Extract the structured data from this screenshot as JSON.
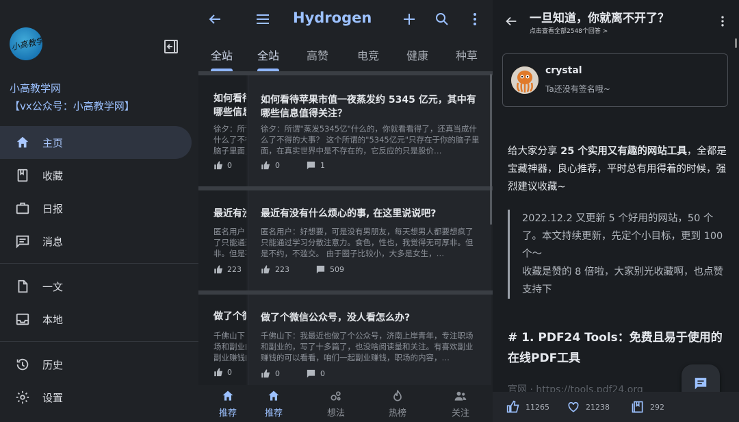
{
  "drawer": {
    "avatar_text": "小高教学网",
    "name": "小高教学网",
    "subtitle": "【vx公众号：小高教学网】",
    "items": [
      {
        "label": "主页",
        "icon": "home-icon"
      },
      {
        "label": "收藏",
        "icon": "bookmark-icon"
      },
      {
        "label": "日报",
        "icon": "briefcase-icon"
      },
      {
        "label": "消息",
        "icon": "message-icon"
      },
      {
        "label": "一文",
        "icon": "document-icon"
      },
      {
        "label": "本地",
        "icon": "inbox-icon"
      },
      {
        "label": "历史",
        "icon": "history-icon"
      },
      {
        "label": "设置",
        "icon": "gear-icon"
      }
    ]
  },
  "list": {
    "app_title": "Hydrogen",
    "ghost_tab": "全站",
    "tabs": [
      "全站",
      "高赞",
      "电竞",
      "健康",
      "种草"
    ],
    "cards": [
      {
        "title": "如何看待苹果市值一夜蒸发约 5345 亿元，其中有哪些信息值得关注？",
        "body": "徐夕：所谓\"蒸发5345亿\"什么的，你就看看得了，还真当成什么了不得的大事？ 这个所谓的\"5345亿元\"只存在于你的脑子里面，在真实世界中是不存在的，它反应的只是股价…",
        "likes": "0",
        "comments": "1",
        "ghost_title_1": "如何看待",
        "ghost_title_2": "哪些信息",
        "ghost_body_1": "徐夕：所谓",
        "ghost_body_2": "什么了不得",
        "ghost_body_3": "脑子里面，"
      },
      {
        "title": "最近有没有什么烦心的事, 在这里说说吧?",
        "body": "匿名用户：好想要，可是没有男朋友，每天想男人都要想疯了只能通过学习分散注意力。食色，性也，我觉得无可厚非。但是不约，不滥交。 由于圈子比较小，大多是女生，…",
        "likes": "223",
        "comments": "509",
        "ghost_title_1": "最近有没",
        "ghost_body_1": "匿名用户：",
        "ghost_body_2": "了只能通过",
        "ghost_body_3": "非。但是不"
      },
      {
        "title": "做了个微信公众号，没人看怎么办?",
        "body": "千佛山下：我最近也做了个公众号，济南上岸青年，专注职场和副业的，写了十多篇了，也没啥阅读量和关注。有喜欢副业赚钱的可以看看，咱们一起副业赚钱，职场的内容，…",
        "likes": "0",
        "comments": "0",
        "ghost_title_1": "做了个微",
        "ghost_body_1": "千佛山下：",
        "ghost_body_2": "场和副业的",
        "ghost_body_3": "副业赚钱的"
      }
    ],
    "bottom_nav": [
      {
        "label": "推荐",
        "icon": "home-icon"
      },
      {
        "label": "想法",
        "icon": "ideas-icon"
      },
      {
        "label": "热榜",
        "icon": "flame-icon"
      },
      {
        "label": "关注",
        "icon": "people-icon"
      }
    ],
    "ghost_nav_label": "推荐"
  },
  "article": {
    "title": "一旦知道，你就离不开了？",
    "subtitle": "点击查看全部2548个回答 >",
    "author_name": "crystal",
    "author_signature": "Ta还没有签名哦~",
    "intro_plain_1": "给大家分享 ",
    "intro_bold": "25 个实用又有趣的网站工具",
    "intro_plain_2": "，全都是宝藏神器，良心推荐，平时总有用得着的时候，强烈建议收藏~",
    "quote_1": "2022.12.2 又更新 5 个好用的网站，50 个了。本文持续更新，先定个小目标，更到 100 个～",
    "quote_2": "收藏是赞的 8 倍啦，大家别光收藏啊，也点赞支持下",
    "heading": "# 1. PDF24 Tools：免费且易于使用的在线PDF工具",
    "fade_text": "官网 · https://tools.pdf24.org",
    "likes": "11265",
    "favorites": "21238",
    "collections": "292"
  }
}
